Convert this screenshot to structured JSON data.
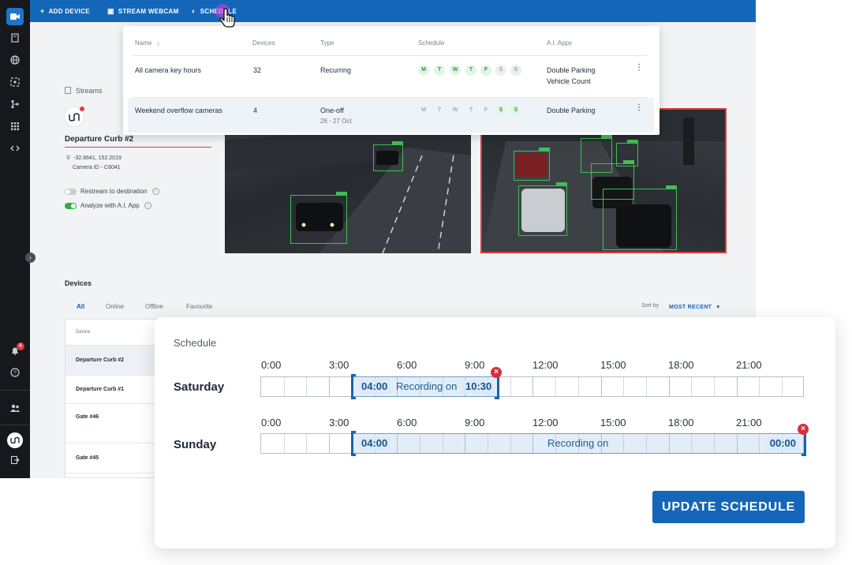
{
  "topbar": {
    "items": [
      {
        "label": "ADD DEVICE",
        "icon": "plus-icon"
      },
      {
        "label": "STREAM WEBCAM",
        "icon": "webcam-icon"
      },
      {
        "label": "SCHEDULE",
        "icon": "schedule-icon"
      }
    ]
  },
  "sidebar": {
    "icons": [
      "camera-icon",
      "book-icon",
      "globe-icon",
      "target-icon",
      "workflow-icon",
      "apps-icon",
      "code-icon",
      "bell-icon",
      "help-icon",
      "users-icon",
      "logout-icon"
    ],
    "notification_count": "4"
  },
  "streams": {
    "label": "Streams",
    "device_name": "Departure Curb #2",
    "coordinates": "-32.8641, 152.2019",
    "camera_id": "Camera ID - C6041",
    "restream_label": "Restream to destination",
    "restream_on": false,
    "analyze_label": "Analyze with A.I. App",
    "analyze_on": true
  },
  "schedule_dropdown": {
    "columns": {
      "name": "Name",
      "devices": "Devices",
      "type": "Type",
      "schedule": "Schedule",
      "apps": "A.I. Apps"
    },
    "rows": [
      {
        "name": "All camera key hours",
        "devices": "32",
        "type": "Recurring",
        "type_sub": "",
        "days": [
          {
            "d": "M",
            "on": true
          },
          {
            "d": "T",
            "on": true
          },
          {
            "d": "W",
            "on": true
          },
          {
            "d": "T",
            "on": true
          },
          {
            "d": "F",
            "on": true
          },
          {
            "d": "S",
            "on": false
          },
          {
            "d": "S",
            "on": false
          }
        ],
        "apps_line1": "Double Parking",
        "apps_line2": "Vehicle Count"
      },
      {
        "name": "Weekend overflow cameras",
        "devices": "4",
        "type": "One-off",
        "type_sub": "26 - 27 Oct",
        "days": [
          {
            "d": "M",
            "on": false
          },
          {
            "d": "T",
            "on": false
          },
          {
            "d": "W",
            "on": false
          },
          {
            "d": "T",
            "on": false
          },
          {
            "d": "F",
            "on": false
          },
          {
            "d": "S",
            "on": true
          },
          {
            "d": "S",
            "on": true
          }
        ],
        "apps_line1": "Double Parking",
        "apps_line2": ""
      }
    ]
  },
  "devices": {
    "title": "Devices",
    "filters": [
      "All",
      "Online",
      "Offline",
      "Favourite"
    ],
    "active_filter": "All",
    "sort_label": "Sort by",
    "sort_value": "MOST RECENT",
    "table_header": "Device",
    "rows": [
      "Departure Curb #2",
      "Departure Curb #1",
      "Gate #46",
      "Gate #45"
    ]
  },
  "schedule_card": {
    "title": "Schedule",
    "hour_labels": [
      "0:00",
      "3:00",
      "6:00",
      "9:00",
      "12:00",
      "15:00",
      "18:00",
      "21:00"
    ],
    "days": [
      {
        "day": "Saturday",
        "start": "04:00",
        "end": "10:30",
        "label": "Recording on"
      },
      {
        "day": "Sunday",
        "start": "04:00",
        "end": "00:00",
        "label": "Recording on"
      }
    ],
    "button_label": "UPDATE SCHEDULE"
  },
  "colors": {
    "brand_blue": "#1467b8",
    "sidebar_bg": "#16181c",
    "active_green": "#2fae4a",
    "alert_red": "#e0393e"
  }
}
